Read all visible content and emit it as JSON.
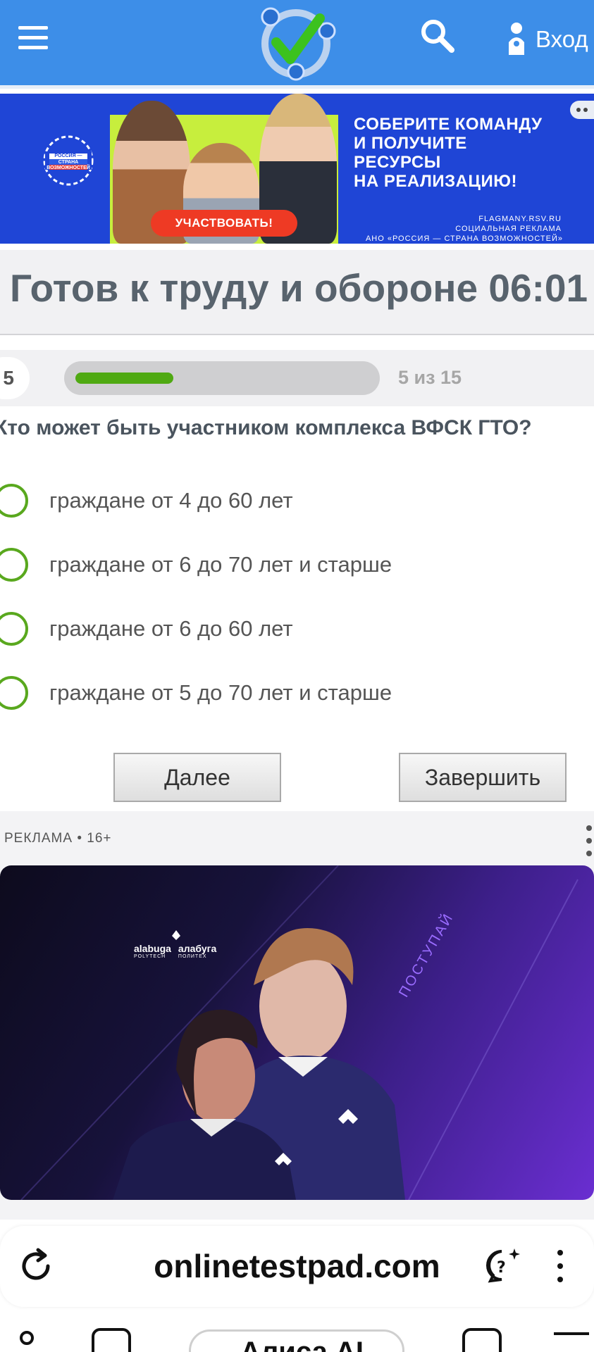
{
  "header": {
    "login_label": "Вход"
  },
  "banner": {
    "headline_lines": [
      "СОБЕРИТЕ КОМАНДУ",
      "И ПОЛУЧИТЕ",
      "РЕСУРСЫ",
      "НА РЕАЛИЗАЦИЮ!"
    ],
    "cta_label": "УЧАСТВОВАТЬ!",
    "site": "FLAGMANY.RSV.RU",
    "social_ad": "СОЦИАЛЬНАЯ РЕКЛАМА",
    "org": "АНО «РОССИЯ — СТРАНА ВОЗМОЖНОСТЕЙ»",
    "emblem_line1": "РОССИЯ —",
    "emblem_line2": "СТРАНА",
    "emblem_line3": "ВОЗМОЖНОСТЕЙ"
  },
  "test": {
    "title": "Готов к труду и обороне 06:01",
    "question_number": "5",
    "progress_text": "5 из 15",
    "progress_fraction": 0.333,
    "question": "Кто может быть участником комплекса ВФСК ГТО?",
    "options": [
      "граждане от 4 до 60 лет",
      "граждане от 6 до 70 лет и старше",
      "граждане от 6 до 60 лет",
      "граждане от 5 до 70 лет и старше"
    ],
    "next_label": "Далее",
    "finish_label": "Завершить"
  },
  "ad": {
    "label": "РЕКЛАМА • 16+",
    "brand_left": "alabuga",
    "brand_left_sub": "POLYTECH",
    "brand_right": "алабуга",
    "brand_right_sub": "ПОЛИТЕХ",
    "slogan": "ПОСТУПАЙ"
  },
  "browser": {
    "url": "onlinetestpad.com",
    "bottom_pill_text": "Алиса AI"
  },
  "colors": {
    "header_bg": "#3d8ee8",
    "accent_green": "#4fa912",
    "banner_blue": "#1f45d6"
  }
}
